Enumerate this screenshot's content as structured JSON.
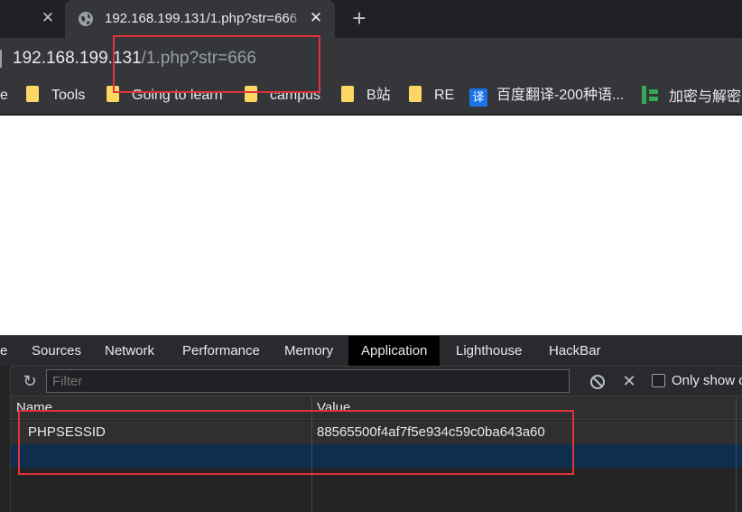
{
  "tabs": {
    "active_title": "192.168.199.131/1.php?str=666"
  },
  "address": {
    "host": "192.168.199.131",
    "path": "/1.php?str=666"
  },
  "bookmarks": {
    "cut_label": "e",
    "items": [
      {
        "label": "Tools",
        "icon": "folder-icon"
      },
      {
        "label": "Going to learn",
        "icon": "folder-icon"
      },
      {
        "label": "campus",
        "icon": "folder-icon"
      },
      {
        "label": "B站",
        "icon": "folder-icon"
      },
      {
        "label": "RE",
        "icon": "folder-icon"
      },
      {
        "label": "百度翻译-200种语...",
        "icon": "translate-icon",
        "icon_text": "译"
      },
      {
        "label": "加密与解密",
        "icon": "bookmark-site-icon"
      }
    ]
  },
  "devtools": {
    "tabs": [
      "e",
      "Sources",
      "Network",
      "Performance",
      "Memory",
      "Application",
      "Lighthouse",
      "HackBar"
    ],
    "active_tab": "Application",
    "filter_placeholder": "Filter",
    "only_show_label": "Only show c",
    "columns": [
      "Name",
      "Value"
    ],
    "cookies": [
      {
        "name": "PHPSESSID",
        "value": "88565500f4af7f5e934c59c0ba643a60"
      }
    ]
  },
  "colors": {
    "annotation": "#e0323a",
    "selected_row": "#0d2e4f",
    "folder": "#fdd663"
  }
}
